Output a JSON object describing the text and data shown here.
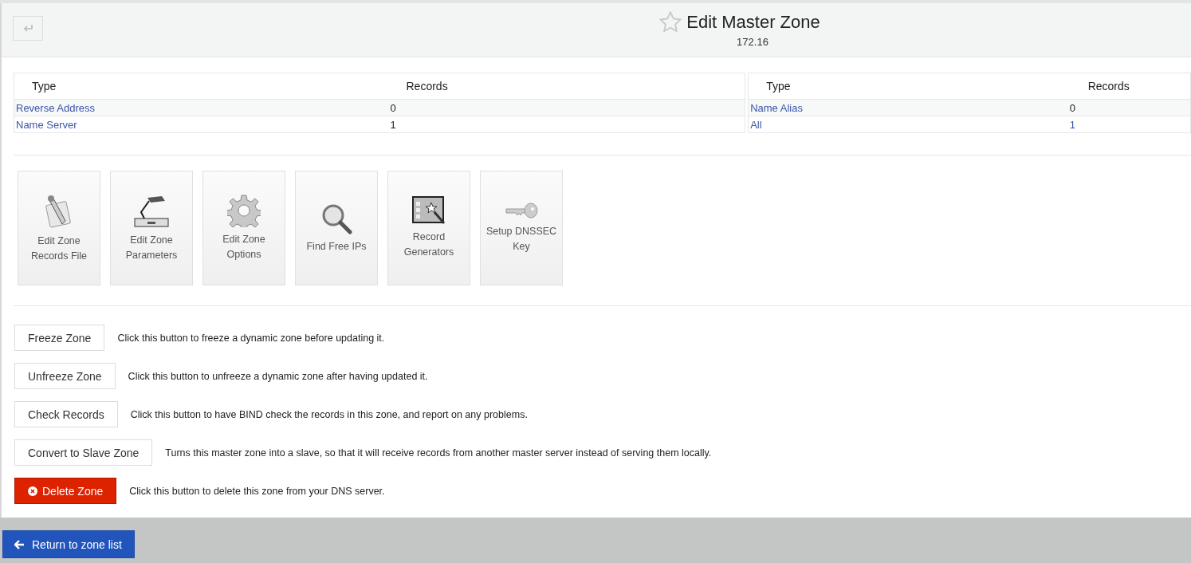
{
  "header": {
    "title": "Edit Master Zone",
    "subtitle": "172.16",
    "starred": false
  },
  "record_tables": [
    {
      "columns": [
        "Type",
        "Records"
      ],
      "rows": [
        {
          "type": "Reverse Address",
          "records": "0"
        },
        {
          "type": "Name Server",
          "records": "1"
        }
      ]
    },
    {
      "columns": [
        "Type",
        "Records"
      ],
      "rows": [
        {
          "type": "Name Alias",
          "records": "0"
        },
        {
          "type": "All",
          "records": "1"
        }
      ]
    }
  ],
  "tiles": [
    {
      "label": "Edit Zone Records File"
    },
    {
      "label": "Edit Zone Parameters"
    },
    {
      "label": "Edit Zone Options"
    },
    {
      "label": "Find Free IPs"
    },
    {
      "label": "Record Generators"
    },
    {
      "label": "Setup DNSSEC Key"
    }
  ],
  "actions": [
    {
      "kind": "default",
      "label": "Freeze Zone",
      "description": "Click this button to freeze a dynamic zone before updating it."
    },
    {
      "kind": "default",
      "label": "Unfreeze Zone",
      "description": "Click this button to unfreeze a dynamic zone after having updated it."
    },
    {
      "kind": "default",
      "label": "Check Records",
      "description": "Click this button to have BIND check the records in this zone, and report on any problems."
    },
    {
      "kind": "default",
      "label": "Convert to Slave Zone",
      "description": "Turns this master zone into a slave, so that it will receive records from another master server instead of serving them locally."
    },
    {
      "kind": "danger",
      "label": "Delete Zone",
      "description": "Click this button to delete this zone from your DNS server."
    }
  ],
  "footer": {
    "button": "Return to zone list"
  }
}
